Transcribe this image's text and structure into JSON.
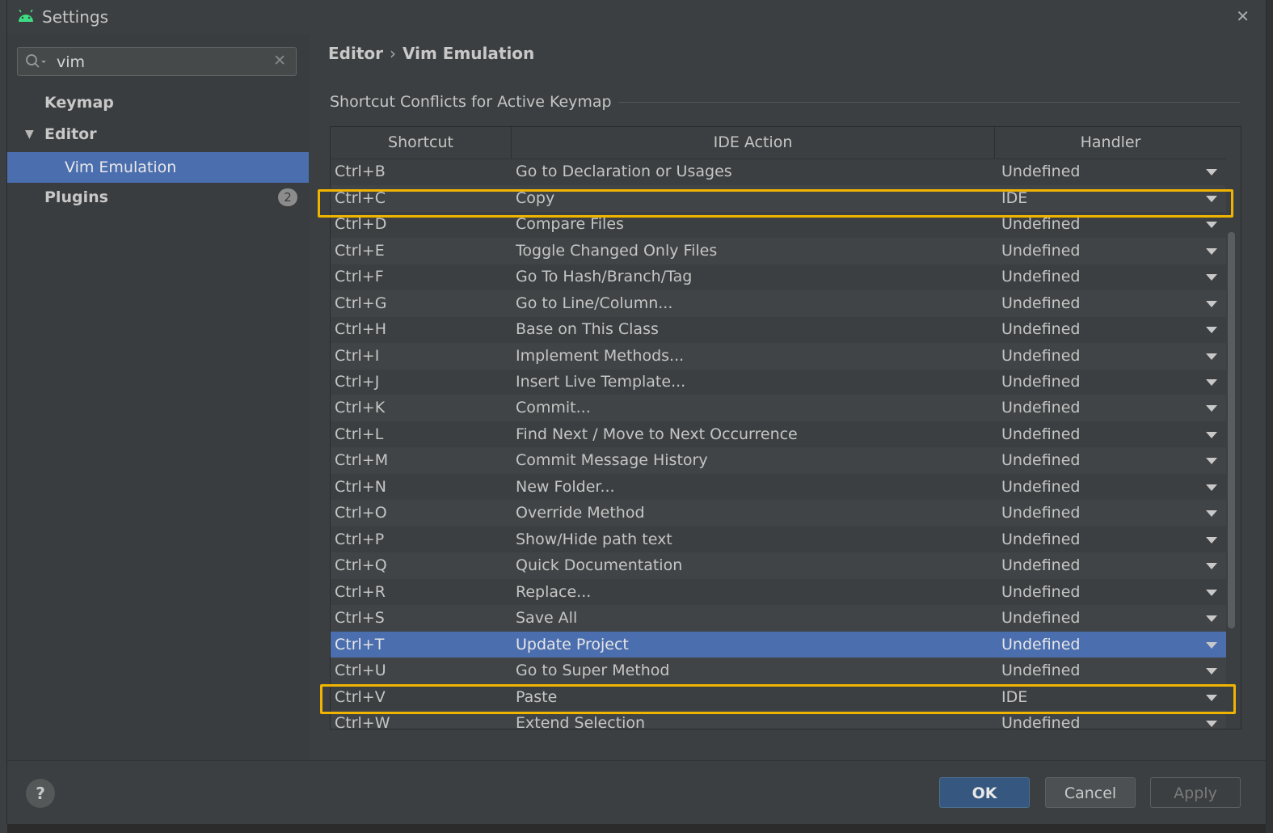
{
  "window": {
    "title": "Settings"
  },
  "sidebar": {
    "search": {
      "value": "vim"
    },
    "items": [
      {
        "label": "Keymap"
      },
      {
        "label": "Editor"
      },
      {
        "label": "Vim Emulation"
      },
      {
        "label": "Plugins",
        "badge": "2"
      }
    ]
  },
  "breadcrumb": {
    "parent": "Editor",
    "separator": "›",
    "current": "Vim Emulation"
  },
  "section": {
    "title": "Shortcut Conflicts for Active Keymap"
  },
  "table": {
    "columns": [
      "Shortcut",
      "IDE Action",
      "Handler"
    ],
    "rows": [
      {
        "shortcut": "Ctrl+B",
        "action": "Go to Declaration or Usages",
        "handler": "Undefined"
      },
      {
        "shortcut": "Ctrl+C",
        "action": "Copy",
        "handler": "IDE"
      },
      {
        "shortcut": "Ctrl+D",
        "action": "Compare Files",
        "handler": "Undefined"
      },
      {
        "shortcut": "Ctrl+E",
        "action": "Toggle Changed Only Files",
        "handler": "Undefined"
      },
      {
        "shortcut": "Ctrl+F",
        "action": "Go To Hash/Branch/Tag",
        "handler": "Undefined"
      },
      {
        "shortcut": "Ctrl+G",
        "action": "Go to Line/Column...",
        "handler": "Undefined"
      },
      {
        "shortcut": "Ctrl+H",
        "action": "Base on This Class",
        "handler": "Undefined"
      },
      {
        "shortcut": "Ctrl+I",
        "action": "Implement Methods...",
        "handler": "Undefined"
      },
      {
        "shortcut": "Ctrl+J",
        "action": "Insert Live Template...",
        "handler": "Undefined"
      },
      {
        "shortcut": "Ctrl+K",
        "action": "Commit...",
        "handler": "Undefined"
      },
      {
        "shortcut": "Ctrl+L",
        "action": "Find Next / Move to Next Occurrence",
        "handler": "Undefined"
      },
      {
        "shortcut": "Ctrl+M",
        "action": "Commit Message History",
        "handler": "Undefined"
      },
      {
        "shortcut": "Ctrl+N",
        "action": "New Folder...",
        "handler": "Undefined"
      },
      {
        "shortcut": "Ctrl+O",
        "action": "Override Method",
        "handler": "Undefined"
      },
      {
        "shortcut": "Ctrl+P",
        "action": "Show/Hide path text",
        "handler": "Undefined"
      },
      {
        "shortcut": "Ctrl+Q",
        "action": "Quick Documentation",
        "handler": "Undefined"
      },
      {
        "shortcut": "Ctrl+R",
        "action": "Replace...",
        "handler": "Undefined"
      },
      {
        "shortcut": "Ctrl+S",
        "action": "Save All",
        "handler": "Undefined"
      },
      {
        "shortcut": "Ctrl+T",
        "action": "Update Project",
        "handler": "Undefined"
      },
      {
        "shortcut": "Ctrl+U",
        "action": "Go to Super Method",
        "handler": "Undefined"
      },
      {
        "shortcut": "Ctrl+V",
        "action": "Paste",
        "handler": "IDE"
      },
      {
        "shortcut": "Ctrl+W",
        "action": "Extend Selection",
        "handler": "Undefined"
      }
    ]
  },
  "footer": {
    "help": "?",
    "ok": "OK",
    "cancel": "Cancel",
    "apply": "Apply"
  },
  "colors": {
    "selection": "#4b6eaf",
    "highlight": "#f0b400",
    "android_green": "#3ddc84"
  }
}
